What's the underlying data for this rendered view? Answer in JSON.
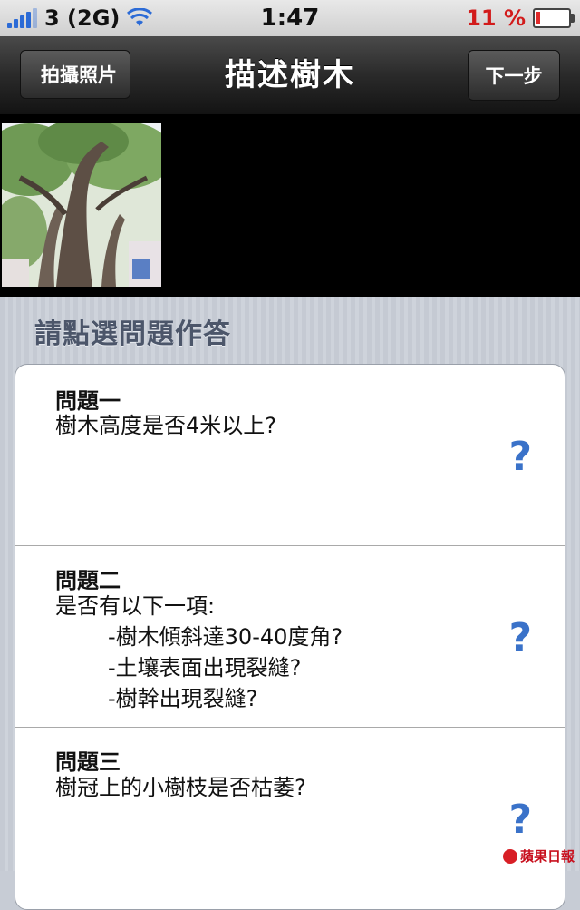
{
  "status_bar": {
    "carrier": "3 (2G)",
    "time": "1:47",
    "battery_percent": "11 %",
    "battery_level": 0.11,
    "icons": [
      "signal-icon",
      "wifi-icon",
      "battery-icon"
    ]
  },
  "nav": {
    "back_label": "拍攝照片",
    "title": "描述樹木",
    "next_label": "下一步"
  },
  "content": {
    "section_header": "請點選問題作答",
    "questions": [
      {
        "title": "問題一",
        "lines": [
          "樹木高度是否4米以上?"
        ],
        "help_icon": "?"
      },
      {
        "title": "問題二",
        "lines": [
          "是否有以下一項:",
          "-樹木傾斜達30-40度角?",
          "-土壤表面出現裂縫?",
          "-樹幹出現裂縫?"
        ],
        "help_icon": "?"
      },
      {
        "title": "問題三",
        "lines": [
          "樹冠上的小樹枝是否枯萎?"
        ],
        "help_icon": "?"
      }
    ]
  },
  "watermark": "蘋果日報",
  "colors": {
    "accent_blue": "#3a72c9",
    "battery_red": "#d21b1b",
    "header_text": "#4c566a"
  }
}
